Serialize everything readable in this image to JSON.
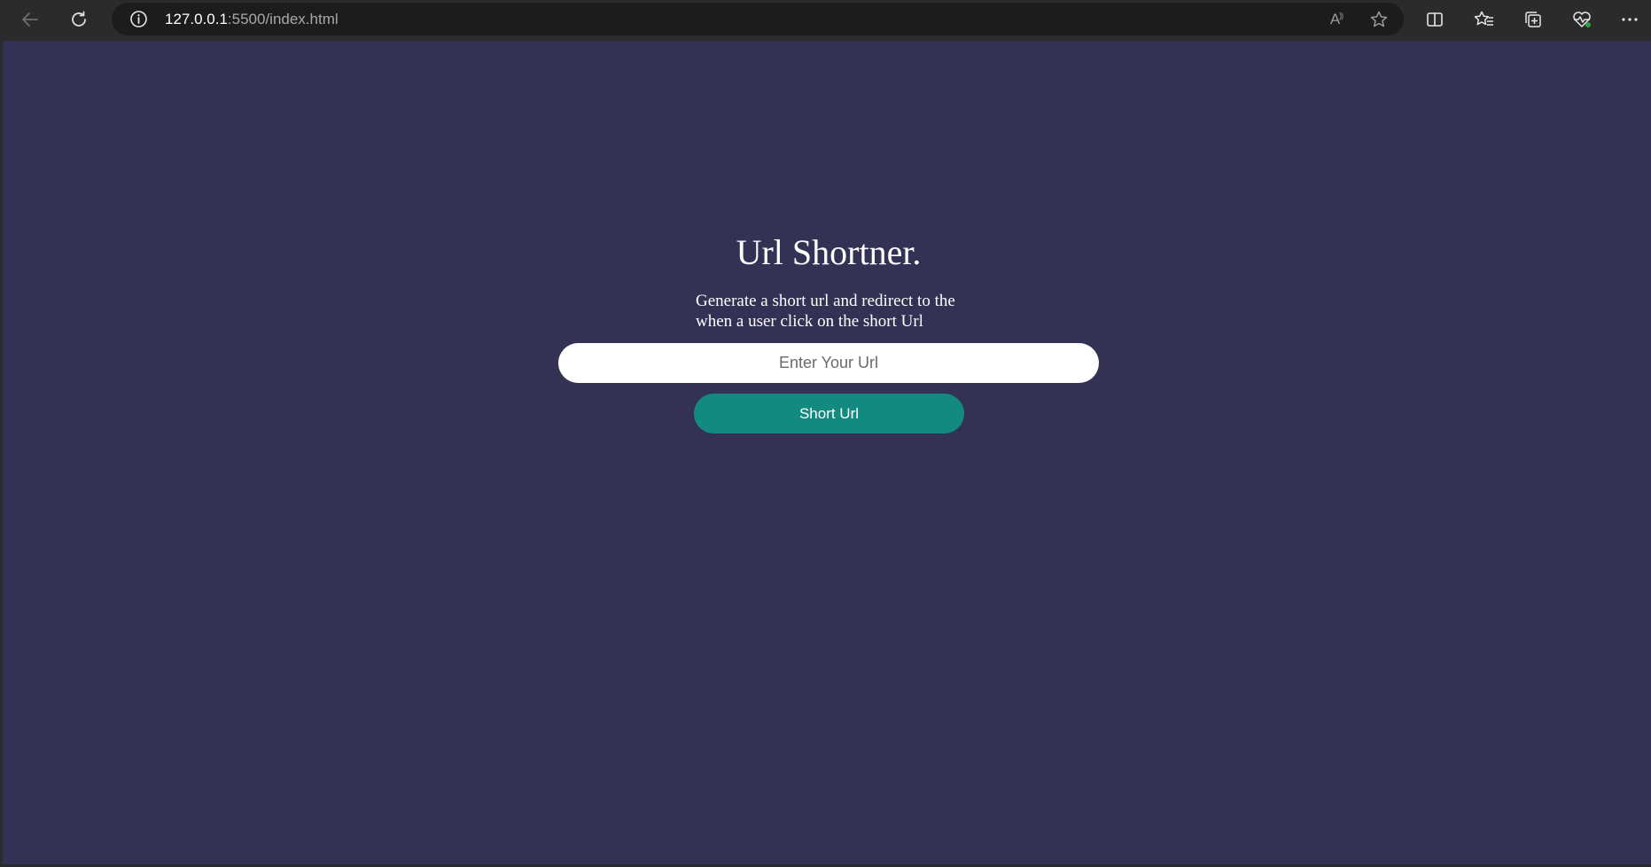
{
  "browser": {
    "url_host": "127.0.0.1",
    "url_rest": ":5500/index.html",
    "read_aloud_label": "A",
    "icons": {
      "back": "back-arrow-icon",
      "refresh": "refresh-icon",
      "site_info": "info-icon",
      "read_aloud": "read-aloud-icon",
      "favorite": "star-icon",
      "split_screen": "split-screen-icon",
      "favorites": "favorites-list-icon",
      "collections": "collections-icon",
      "browser_essentials": "heart-pulse-icon",
      "more": "more-dots-icon"
    }
  },
  "page": {
    "title": "Url Shortner.",
    "subtitle": "Generate a short url and redirect to the when a user click on the short Url",
    "input_placeholder": "Enter Your Url",
    "input_value": "",
    "button_label": "Short Url",
    "colors": {
      "background": "#333154",
      "button": "#138a7f",
      "text": "#ffffff"
    }
  }
}
